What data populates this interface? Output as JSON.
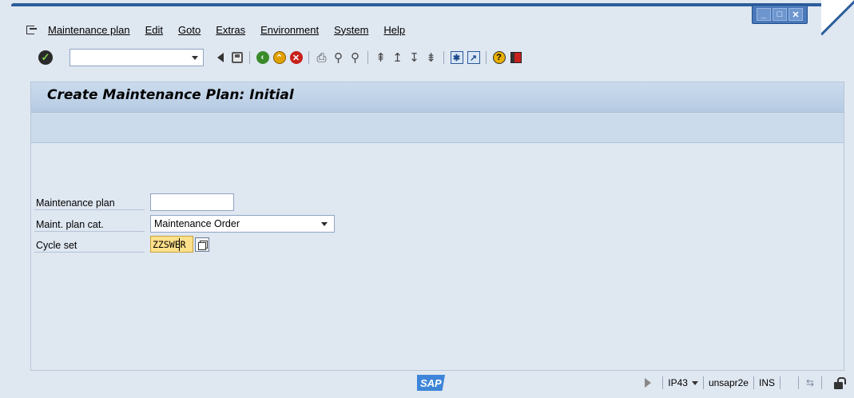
{
  "menubar": {
    "items": [
      {
        "label": "Maintenance plan"
      },
      {
        "label": "Edit"
      },
      {
        "label": "Goto"
      },
      {
        "label": "Extras"
      },
      {
        "label": "Environment"
      },
      {
        "label": "System"
      },
      {
        "label": "Help"
      }
    ]
  },
  "window_controls": {
    "minimize": "minimize-icon",
    "maximize": "maximize-icon",
    "close": "close-icon"
  },
  "toolbar": {
    "command_field_value": "",
    "icons": [
      "enter-icon",
      "back-icon",
      "save-icon",
      "green-back-icon",
      "exit-icon",
      "cancel-icon",
      "print-icon",
      "find-icon",
      "find-next-icon",
      "first-page-icon",
      "previous-page-icon",
      "next-page-icon",
      "last-page-icon",
      "create-session-icon",
      "shortcut-icon",
      "help-icon",
      "customize-layout-icon"
    ]
  },
  "page": {
    "title": "Create Maintenance Plan: Initial"
  },
  "form": {
    "maintenance_plan": {
      "label": "Maintenance plan",
      "value": ""
    },
    "plan_category": {
      "label": "Maint. plan cat.",
      "value": "Maintenance Order"
    },
    "cycle_set": {
      "label": "Cycle set",
      "value": "ZZSWER"
    }
  },
  "statusbar": {
    "logo": "SAP",
    "transaction": "IP43",
    "server": "unsapr2e",
    "mode": "INS"
  },
  "colors": {
    "frame_blue": "#2c5d9a",
    "title_bar": "#b6cbe3",
    "content_bg": "#dfe7f1",
    "focused_field": "#ffe08a",
    "sap_logo_blue": "#3d85d8"
  }
}
